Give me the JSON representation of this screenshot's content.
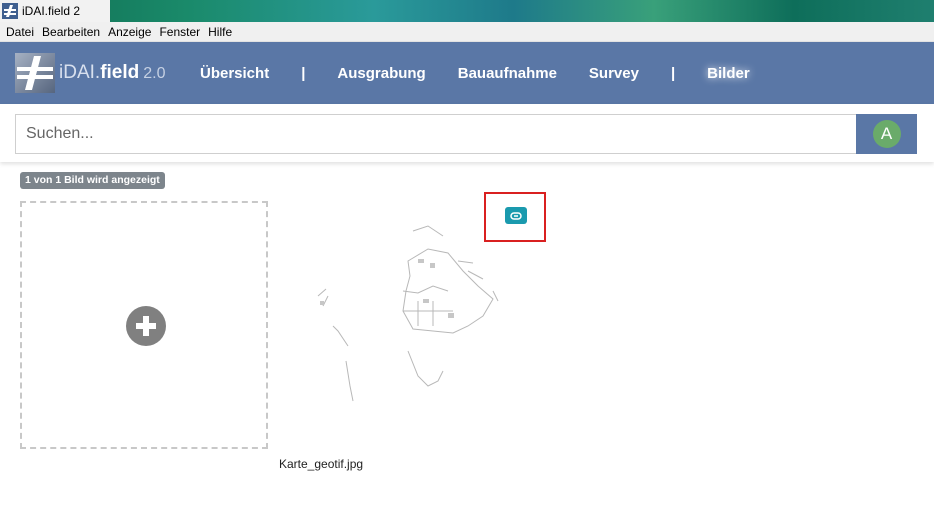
{
  "window": {
    "title": "iDAI.field 2"
  },
  "menu": {
    "items": [
      "Datei",
      "Bearbeiten",
      "Anzeige",
      "Fenster",
      "Hilfe"
    ]
  },
  "navbar": {
    "logo_idai": "iDAI.",
    "logo_field": "field",
    "logo_version": "2.0",
    "links": {
      "uebersicht": "Übersicht",
      "sep1": "|",
      "ausgrabung": "Ausgrabung",
      "bauaufnahme": "Bauaufnahme",
      "survey": "Survey",
      "sep2": "|",
      "bilder": "Bilder"
    },
    "active": "Bilder"
  },
  "search": {
    "placeholder": "Suchen...",
    "value": "",
    "filter_letter": "A"
  },
  "content": {
    "count_badge": "1 von 1 Bild wird angezeigt",
    "images": [
      {
        "label": "Karte_geotif.jpg",
        "linked": true
      }
    ]
  },
  "icons": {
    "add": "plus-circle-icon",
    "link": "link-icon"
  },
  "colors": {
    "navbar": "#5a77a6",
    "link_badge": "#1a9aae",
    "highlight": "#d92020",
    "filter_avatar": "#6aab6a"
  }
}
